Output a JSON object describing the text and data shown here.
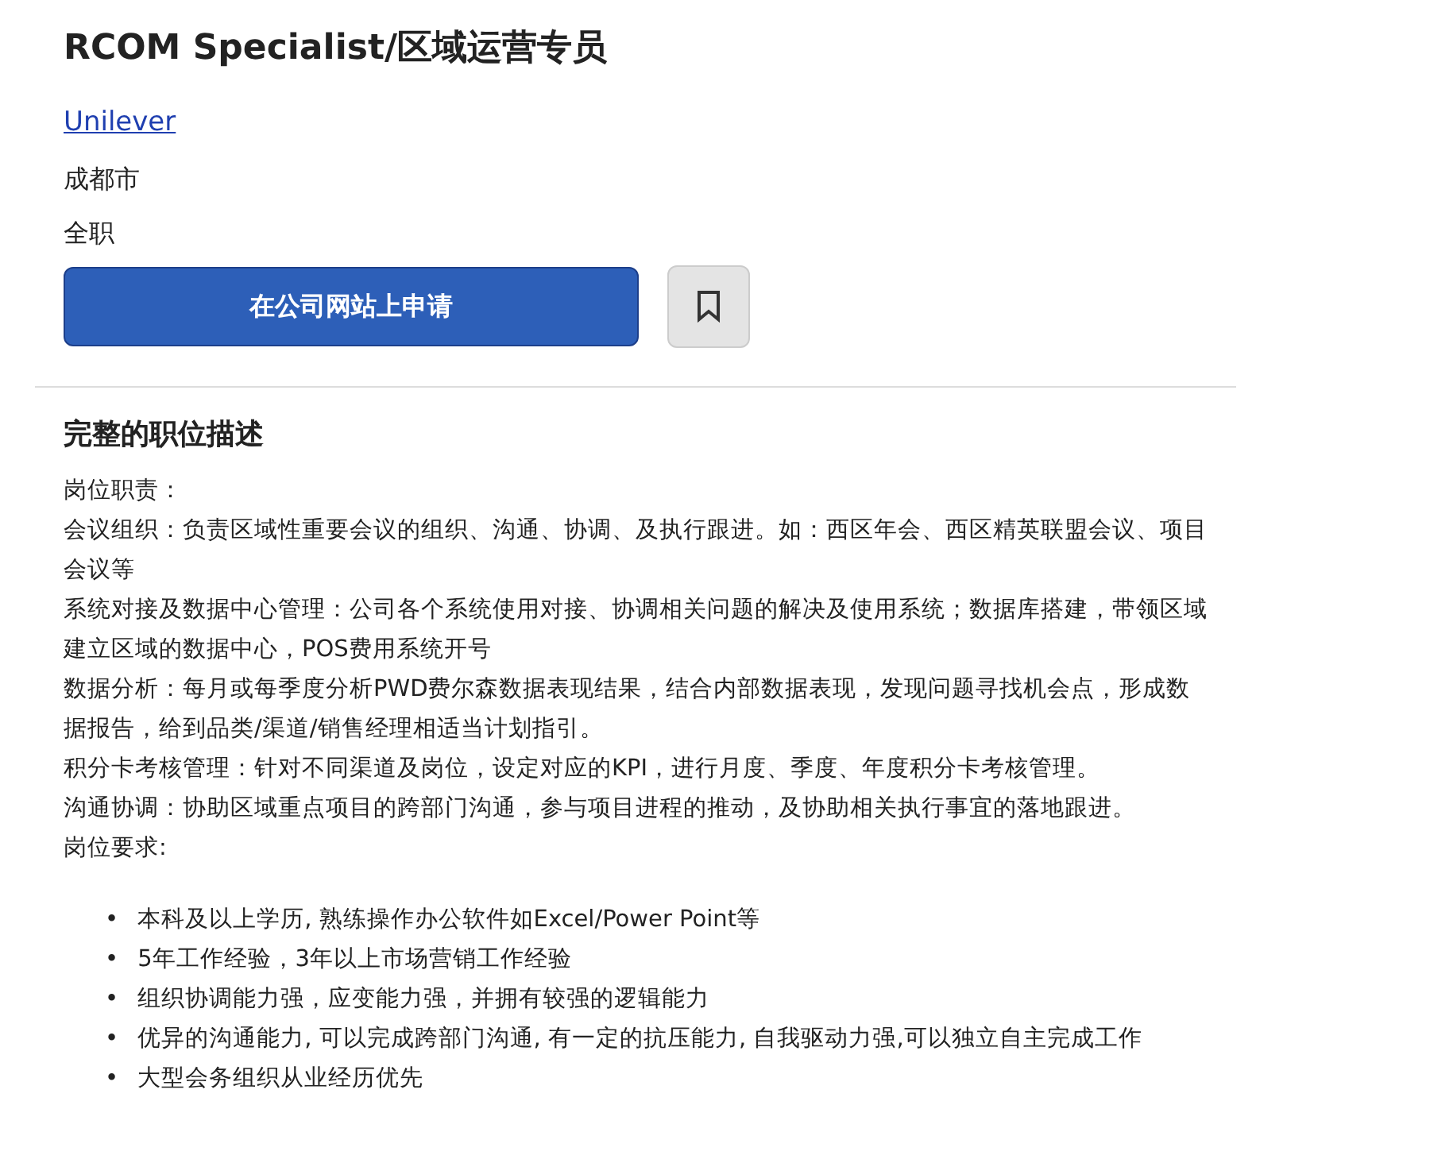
{
  "job": {
    "title": "RCOM Specialist/区域运营专员",
    "company": "Unilever",
    "location": "成都市",
    "type": "全职"
  },
  "actions": {
    "apply": "在公司网站上申请",
    "saved": false
  },
  "description": {
    "heading": "完整的职位描述",
    "paragraphs": [
      "岗位职责：",
      "会议组织：负责区域性重要会议的组织、沟通、协调、及执行跟进。如：西区年会、西区精英联盟会议、项目会议等",
      "系统对接及数据中心管理：公司各个系统使用对接、协调相关问题的解决及使用系统；数据库搭建，带领区域建立区域的数据中心，POS费用系统开号",
      "数据分析：每月或每季度分析PWD费尔森数据表现结果，结合内部数据表现，发现问题寻找机会点，形成数据报告，给到品类/渠道/销售经理相适当计划指引。",
      "积分卡考核管理：针对不同渠道及岗位，设定对应的KPI，进行月度、季度、年度积分卡考核管理。",
      "沟通协调：协助区域重点项目的跨部门沟通，参与项目进程的推动，及协助相关执行事宜的落地跟进。",
      "岗位要求:"
    ],
    "requirements": [
      {
        "bullet": "•",
        "text": "本科及以上学历, 熟练操作办公软件如Excel/Power Point等"
      },
      {
        "bullet": "•",
        "text": "5年工作经验，3年以上市场营销工作经验"
      },
      {
        "bullet": "•",
        "text": "组织协调能力强，应变能力强，并拥有较强的逻辑能力"
      },
      {
        "bullet": "•",
        "text": "优异的沟通能力, 可以完成跨部门沟通, 有一定的抗压能力, 自我驱动力强,可以独立自主完成工作"
      },
      {
        "bullet": "•",
        "text": "大型会务组织从业经历优先"
      }
    ]
  }
}
